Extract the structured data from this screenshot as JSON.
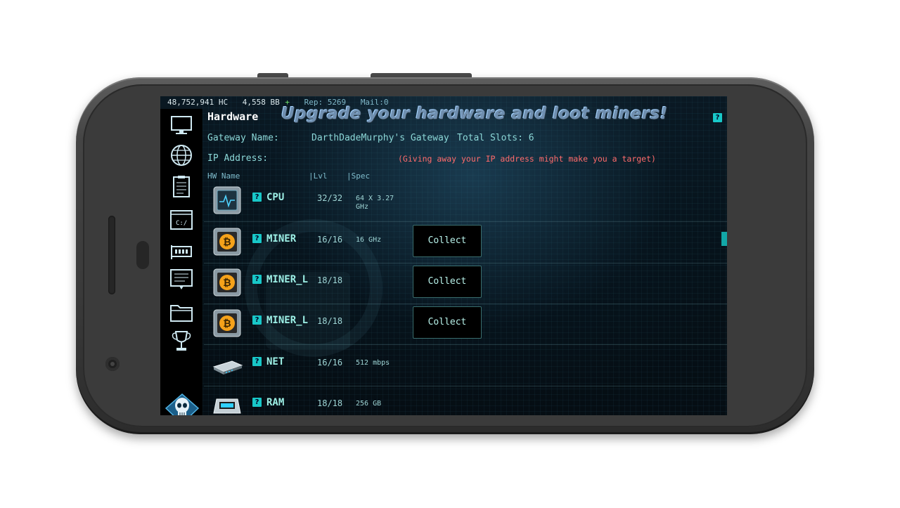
{
  "statusbar": {
    "hc": "48,752,941 HC",
    "bb": "4,558 BB",
    "bb_plus": "+",
    "rep": "Rep: 5269",
    "mail": "Mail:0"
  },
  "header": {
    "title": "Hardware",
    "banner": "Upgrade your hardware and loot miners!",
    "help_label": "?"
  },
  "gateway": {
    "name_label": "Gateway Name:",
    "name_value": "DarthDadeMurphy's Gateway",
    "slots": "Total Slots: 6",
    "ip_label": "IP Address:",
    "ip_warning": "(Giving away your IP address might make you a target)"
  },
  "columns": {
    "name": "HW Name",
    "lvl": "|Lvl",
    "spec": "|Spec"
  },
  "hardware": [
    {
      "name": "CPU",
      "lvl": "32/32",
      "spec": "64 X 3.27 GHz",
      "icon": "cpu-chip-icon"
    },
    {
      "name": "MINER",
      "lvl": "16/16",
      "spec": "16 GHz",
      "action": "Collect",
      "icon": "bitcoin-chip-icon"
    },
    {
      "name": "MINER_L",
      "lvl": "18/18",
      "spec": "",
      "action": "Collect",
      "icon": "bitcoin-chip-icon"
    },
    {
      "name": "MINER_L",
      "lvl": "18/18",
      "spec": "",
      "action": "Collect",
      "icon": "bitcoin-chip-icon"
    },
    {
      "name": "NET",
      "lvl": "16/16",
      "spec": "512 mbps",
      "icon": "router-icon"
    },
    {
      "name": "RAM",
      "lvl": "18/18",
      "spec": "256 GB",
      "icon": "ram-icon"
    }
  ],
  "sidebar": {
    "terminal_label": "C:/",
    "items": [
      "monitor-icon",
      "globe-icon",
      "clipboard-icon",
      "terminal-icon",
      "network-card-icon",
      "chat-icon",
      "folder-icon",
      "trophy-icon",
      "skull-logo-icon"
    ]
  },
  "colors": {
    "accent": "#18c8c8",
    "warning": "#ff6b6b",
    "text": "#8cd8d8"
  }
}
